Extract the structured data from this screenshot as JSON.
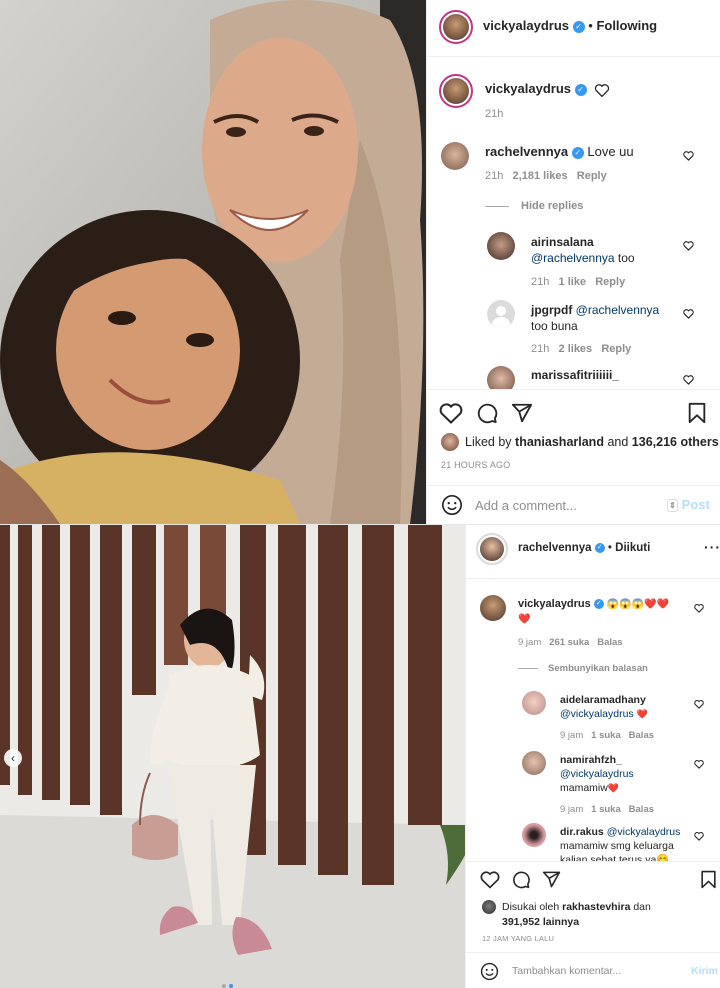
{
  "top_post": {
    "header": {
      "username": "vickyalaydrus",
      "follow_status": "Following"
    },
    "caption": {
      "username": "vickyalaydrus",
      "time": "21h"
    },
    "comments": [
      {
        "username": "rachelvennya",
        "text": "Love uu",
        "time": "21h",
        "likes": "2,181 likes",
        "reply": "Reply"
      }
    ],
    "hide_replies": "Hide replies",
    "replies": [
      {
        "username": "airinsalana",
        "mention": "@rachelvennya",
        "text": "too",
        "time": "21h",
        "likes": "1 like",
        "reply": "Reply"
      },
      {
        "username": "jpgrpdf",
        "mention": "@rachelvennya",
        "text": "too buna",
        "time": "21h",
        "likes": "2 likes",
        "reply": "Reply"
      },
      {
        "username": "marissafitriiiiii_"
      }
    ],
    "likes": {
      "prefix": "Liked by",
      "user": "thaniasharland",
      "middle": "and",
      "others": "136,216 others"
    },
    "timestamp": "21 HOURS AGO",
    "comment_input": {
      "placeholder": "Add a comment...",
      "post_label": "Post"
    }
  },
  "bottom_post": {
    "header": {
      "username": "rachelvennya",
      "follow_status": "Diikuti"
    },
    "comments": [
      {
        "username": "vickyalaydrus",
        "emoji": "😱😱😱❤️❤️",
        "emoji2": "❤️",
        "time": "9 jam",
        "likes": "261 suka",
        "reply": "Balas"
      }
    ],
    "hide_replies": "Sembunyikan balasan",
    "replies": [
      {
        "username": "aidelaramadhany",
        "mention": "@vickyalaydrus",
        "emoji": "❤️",
        "time": "9 jam",
        "likes": "1 suka",
        "reply": "Balas"
      },
      {
        "username": "namirahfzh_",
        "mention": "@vickyalaydrus",
        "text": "mamamiw",
        "emoji": "❤️",
        "time": "9 jam",
        "likes": "1 suka",
        "reply": "Balas"
      },
      {
        "username": "dir.rakus",
        "mention": "@vickyalaydrus",
        "text": "mamamiw smg keluarga",
        "text2": "kalian sehat terus ya😊"
      }
    ],
    "likes": {
      "prefix": "Disukai oleh",
      "user": "rakhastevhira",
      "middle": "dan",
      "others": "391,952 lainnya"
    },
    "timestamp": "12 JAM YANG LALU",
    "comment_input": {
      "placeholder": "Tambahkan komentar...",
      "post_label": "Kirim"
    }
  },
  "colors": {
    "verified": "#3897f0",
    "link": "#00376b",
    "heart": "#ed4956",
    "post_button": "#b2dffc"
  }
}
